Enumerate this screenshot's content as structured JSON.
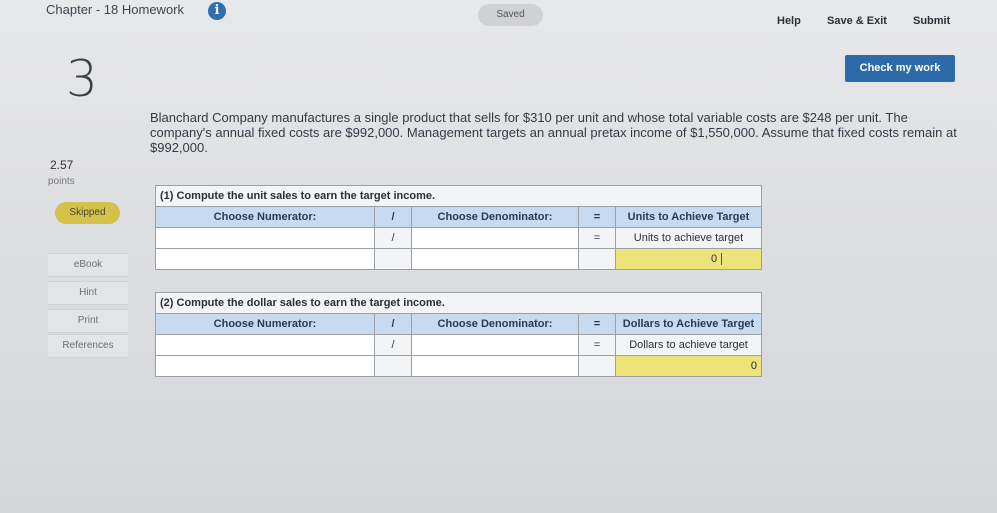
{
  "header": {
    "chapter_title": "Chapter - 18 Homework",
    "info_icon": "info-icon",
    "saved": "Saved",
    "help": "Help",
    "save_exit": "Save & Exit",
    "submit": "Submit",
    "check_work": "Check my work"
  },
  "question": {
    "number": "3",
    "points_value": "2.57",
    "points_label": "points",
    "status": "Skipped",
    "text": "Blanchard Company manufactures a single product that sells for $310 per unit and whose total variable costs are $248 per unit. The company's annual fixed costs are $992,000. Management targets an annual pretax income of $1,550,000. Assume that fixed costs remain at $992,000."
  },
  "sidebar": {
    "ebook": "eBook",
    "hint": "Hint",
    "print": "Print",
    "references": "References"
  },
  "part1": {
    "caption": "(1) Compute the unit sales to earn the target income.",
    "numerator_header": "Choose Numerator:",
    "div_symbol": "/",
    "denominator_header": "Choose Denominator:",
    "eq_symbol": "=",
    "result_header": "Units to Achieve Target",
    "result_label": "Units to achieve target",
    "result_value": "0"
  },
  "part2": {
    "caption": "(2) Compute the dollar sales to earn the target income.",
    "numerator_header": "Choose Numerator:",
    "div_symbol": "/",
    "denominator_header": "Choose Denominator:",
    "eq_symbol": "=",
    "result_header": "Dollars to Achieve Target",
    "result_label": "Dollars to achieve target",
    "result_value": "0"
  }
}
